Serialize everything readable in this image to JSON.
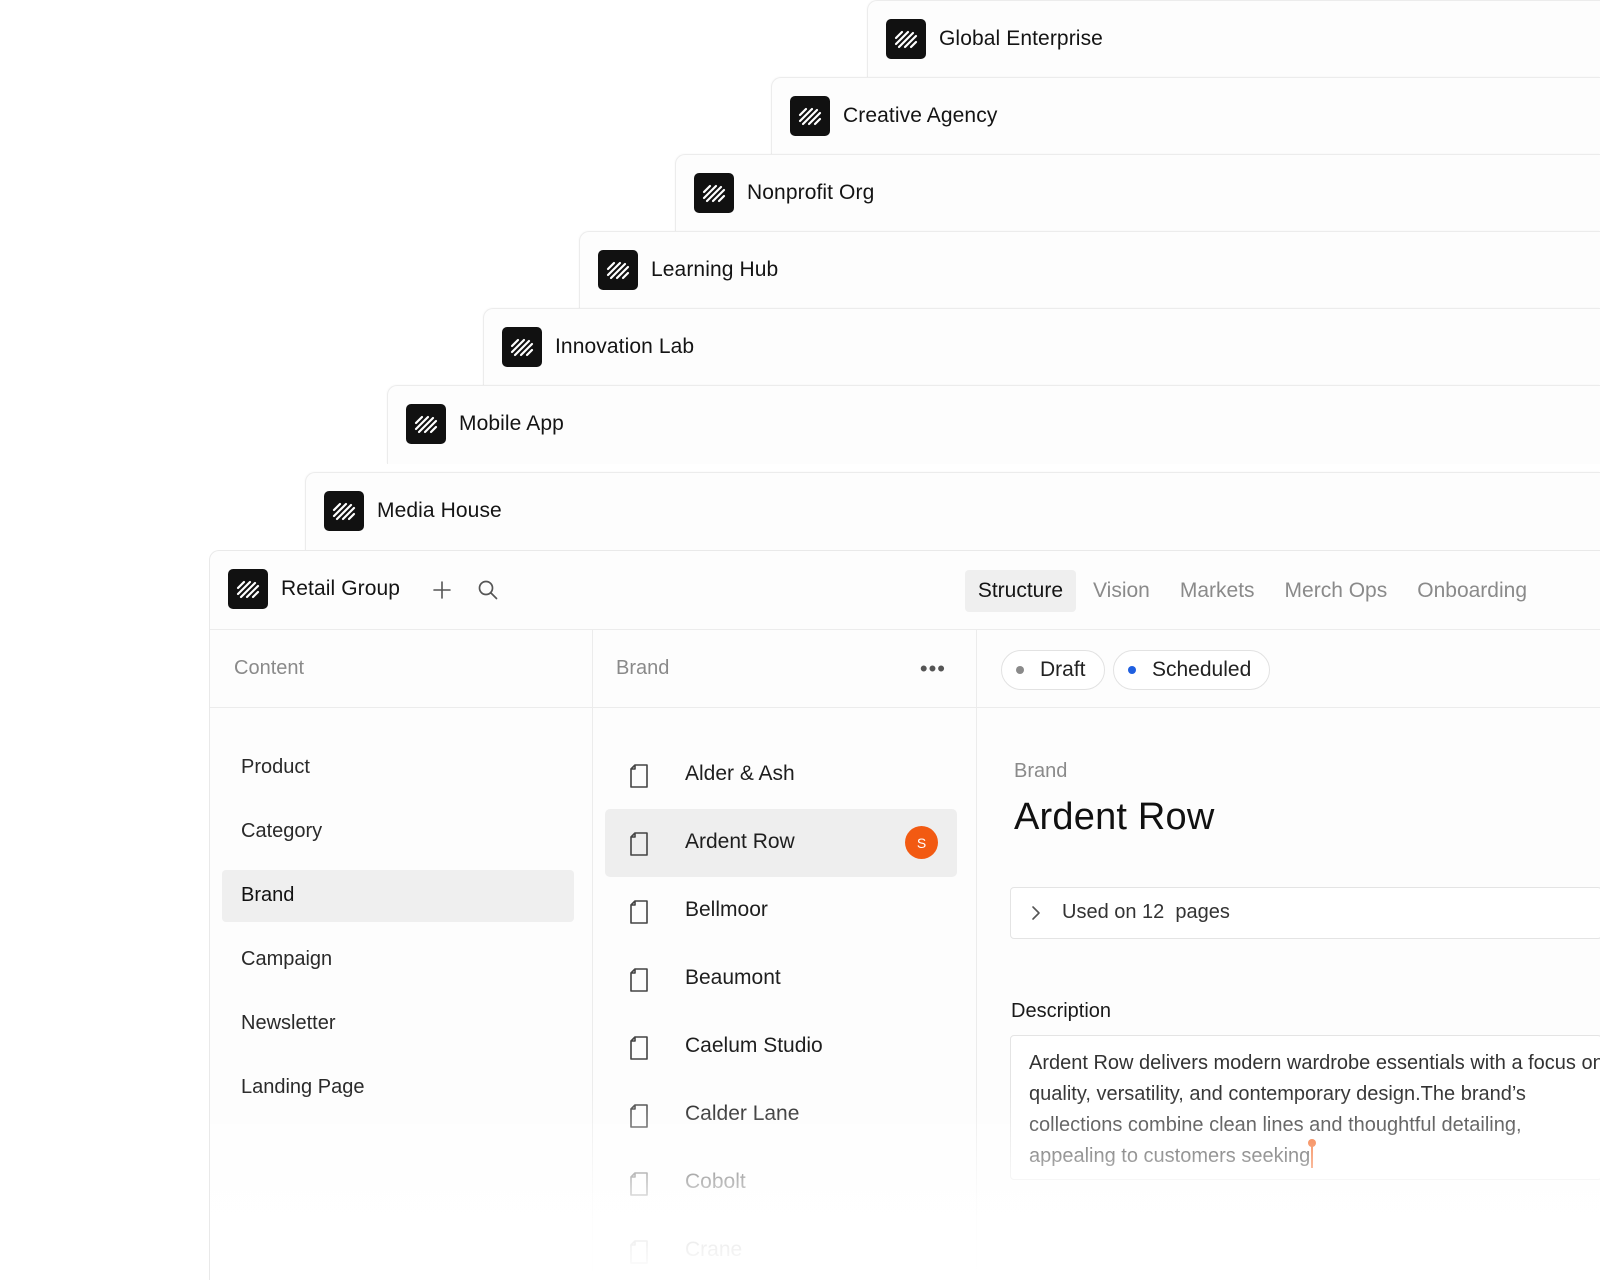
{
  "workspaces": [
    "Global Enterprise",
    "Creative Agency",
    "Nonprofit Org",
    "Learning Hub",
    "Innovation Lab",
    "Mobile App",
    "Media House"
  ],
  "current_workspace": "Retail Group",
  "tabs": [
    "Structure",
    "Vision",
    "Markets",
    "Merch Ops",
    "Onboarding"
  ],
  "active_tab": "Structure",
  "content_column": {
    "header": "Content",
    "items": [
      "Product",
      "Category",
      "Brand",
      "Campaign",
      "Newsletter",
      "Landing Page"
    ],
    "active": "Brand"
  },
  "brand_column": {
    "header": "Brand",
    "more_label": "•••",
    "items": [
      "Alder & Ash",
      "Ardent Row",
      "Bellmoor",
      "Beaumont",
      "Caelum Studio",
      "Calder Lane",
      "Cobolt",
      "Crane"
    ],
    "active": "Ardent Row",
    "active_avatar": "S"
  },
  "status_pills": [
    {
      "label": "Draft",
      "color": "#8a8a8a"
    },
    {
      "label": "Scheduled",
      "color": "#1f5fe0"
    }
  ],
  "detail": {
    "type_label": "Brand",
    "title": "Ardent Row",
    "usage_label": "Used on 12  pages",
    "description_label": "Description",
    "description_lines": [
      "Ardent Row delivers modern wardrobe essentials with a focus on",
      "quality, versatility, and contemporary design.The brand’s",
      "collections combine clean lines and thoughtful detailing,",
      "appealing to customers seeking"
    ]
  },
  "colors": {
    "accent_orange": "#f25a12",
    "scheduled_blue": "#1f5fe0"
  }
}
